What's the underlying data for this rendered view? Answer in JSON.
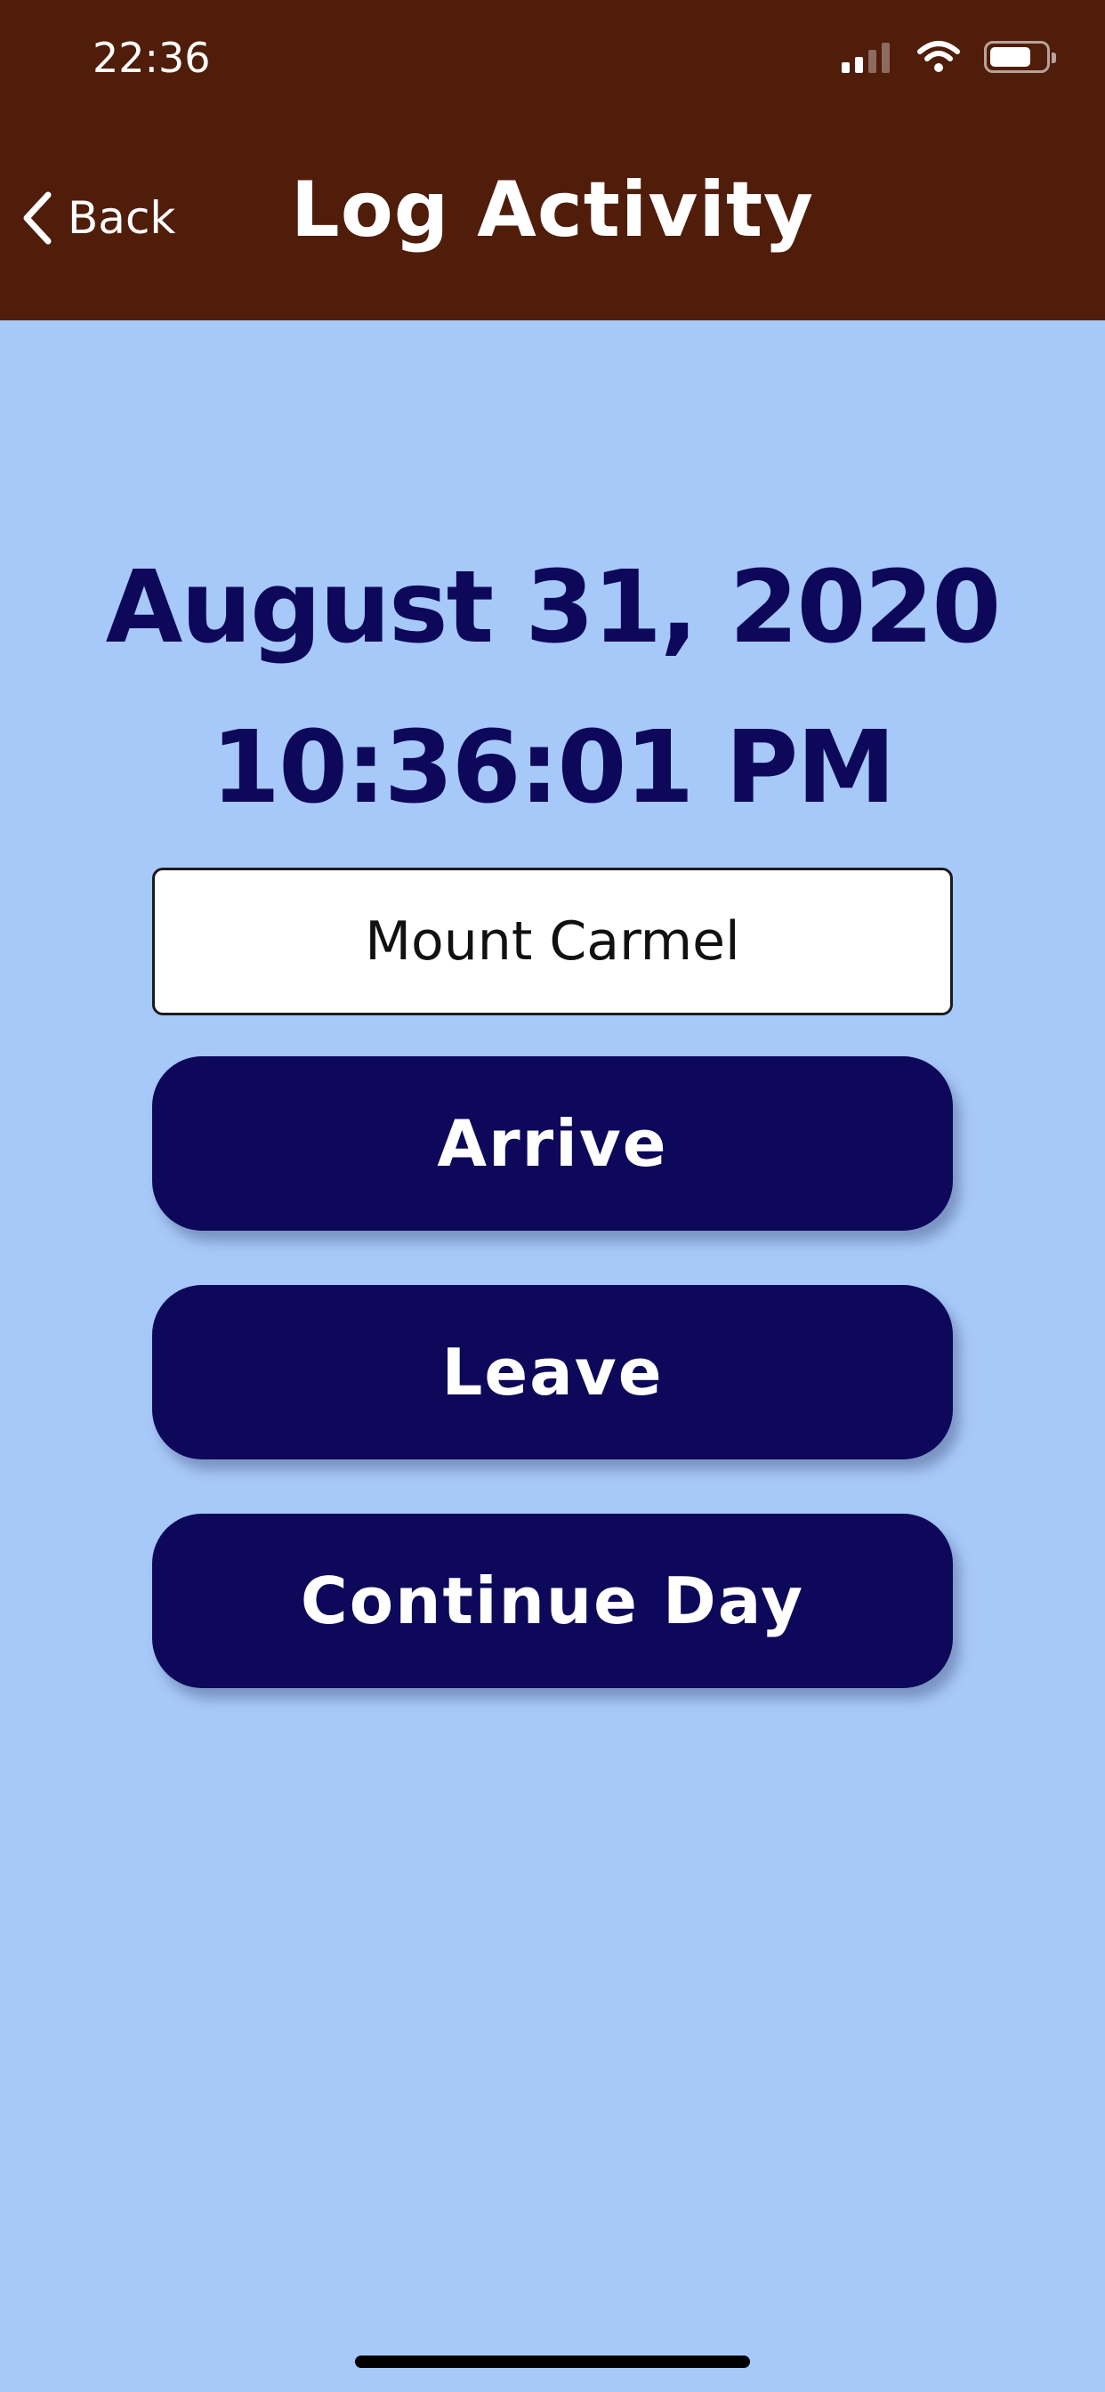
{
  "status_bar": {
    "time": "22:36",
    "icons": [
      "cellular-signal-icon",
      "wifi-icon",
      "battery-icon"
    ],
    "battery_level": 0.75
  },
  "nav": {
    "back_label": "Back",
    "title": "Log Activity"
  },
  "main": {
    "date": "August 31, 2020",
    "time": "10:36:01 PM",
    "location_value": "Mount Carmel",
    "buttons": {
      "arrive": "Arrive",
      "leave": "Leave",
      "continue_day": "Continue Day"
    }
  },
  "colors": {
    "header_bg": "#501d0b",
    "page_bg": "#a7c9f9",
    "primary": "#0e085b",
    "text_on_primary": "#ffffff"
  }
}
